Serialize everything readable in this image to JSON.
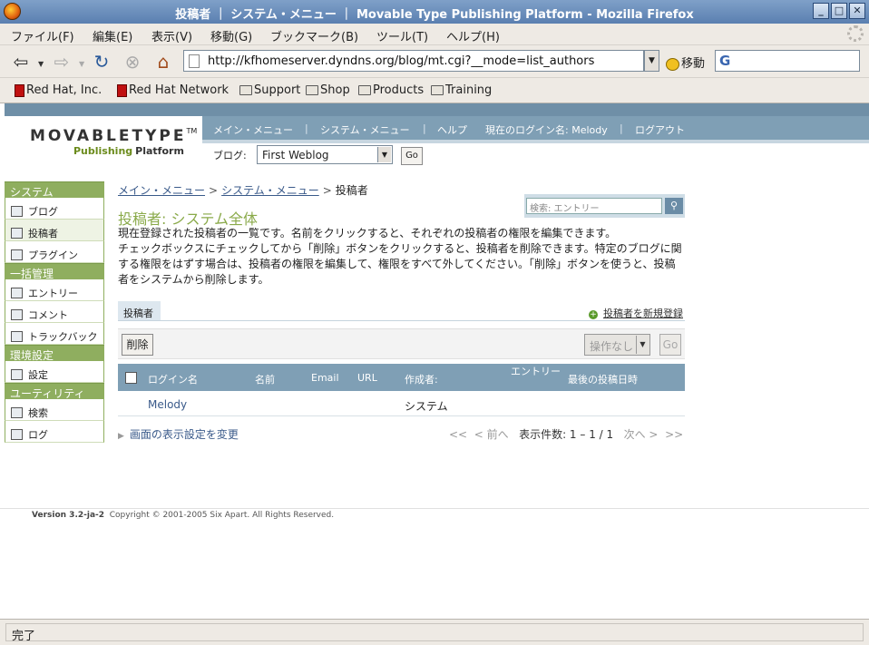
{
  "window": {
    "title": "投稿者 ｜ システム・メニュー ｜ Movable Type Publishing Platform - Mozilla Firefox",
    "min": "_",
    "max": "□",
    "close": "✕"
  },
  "menubar": [
    "ファイル(F)",
    "編集(E)",
    "表示(V)",
    "移動(G)",
    "ブックマーク(B)",
    "ツール(T)",
    "ヘルプ(H)"
  ],
  "navbar": {
    "back": "⇦",
    "forward": "⇨",
    "reload": "↻",
    "stop": "⊗",
    "home": "⌂",
    "url": "http://kfhomeserver.dyndns.org/blog/mt.cgi?__mode=list_authors",
    "go_label": "移動",
    "search_g": "G"
  },
  "bookmarks": [
    "Red Hat, Inc.",
    "Red Hat Network",
    "Support",
    "Shop",
    "Products",
    "Training"
  ],
  "mt": {
    "logo": {
      "word": "MOVABLETYPE",
      "tm": "TM",
      "sub_a": "Publishing",
      "sub_b": "Platform"
    },
    "topnav": [
      "メイン・メニュー",
      "システム・メニュー",
      "ヘルプ",
      "現在のログイン名: Melody",
      "ログアウト"
    ],
    "topnav_sep": "|",
    "blog_label": "ブログ:",
    "blog_value": "First Weblog",
    "blog_go": "Go"
  },
  "sidebar": [
    {
      "type": "head",
      "label": "システム"
    },
    {
      "type": "item",
      "label": "ブログ",
      "icon": "blog-icon"
    },
    {
      "type": "item",
      "label": "投稿者",
      "icon": "authors-icon",
      "active": true
    },
    {
      "type": "item",
      "label": "プラグイン",
      "icon": "plugin-icon"
    },
    {
      "type": "head",
      "label": "一括管理"
    },
    {
      "type": "item",
      "label": "エントリー",
      "icon": "entry-icon"
    },
    {
      "type": "item",
      "label": "コメント",
      "icon": "comment-icon"
    },
    {
      "type": "item",
      "label": "トラックバック",
      "icon": "trackback-icon"
    },
    {
      "type": "head",
      "label": "環境設定"
    },
    {
      "type": "item",
      "label": "設定",
      "icon": "settings-icon"
    },
    {
      "type": "head",
      "label": "ユーティリティ"
    },
    {
      "type": "item",
      "label": "検索",
      "icon": "search-icon"
    },
    {
      "type": "item",
      "label": "ログ",
      "icon": "log-icon"
    }
  ],
  "main": {
    "breadcrumb": {
      "main": "メイン・メニュー",
      "system": "システム・メニュー",
      "current": "投稿者",
      "arrow": ">"
    },
    "search_placeholder": "検索: エントリー",
    "title": "投稿者: システム全体",
    "desc": [
      "現在登録された投稿者の一覧です。名前をクリックすると、それぞれの投稿者の権限を編集できます。",
      "チェックボックスにチェックしてから「削除」ボタンをクリックすると、投稿者を削除できます。特定のブログに関する権限をはずす場合は、投稿者の権限を編集して、権限をすべて外してください。「削除」ボタンを使うと、投稿者をシステムから削除します。"
    ],
    "tab": "投稿者",
    "add_new": "投稿者を新規登録",
    "delete": "削除",
    "ops": "操作なし",
    "ops_go": "Go",
    "columns": [
      "ログイン名",
      "名前",
      "Email",
      "URL",
      "作成者:",
      "エントリー",
      "最後の投稿日時"
    ],
    "rows": [
      {
        "login": "Melody",
        "name": "",
        "email": "",
        "url": "",
        "creator": "システム",
        "entries": "",
        "last": ""
      }
    ],
    "display_options": "画面の表示設定を変更",
    "pager": {
      "first": "<<",
      "prev": "< 前へ",
      "count": "表示件数: 1 – 1 / 1",
      "next": "次へ >",
      "last": ">>"
    }
  },
  "footer": {
    "version": "Version 3.2-ja-2",
    "copyright": "Copyright © 2001-2005 Six Apart. All Rights Reserved."
  },
  "status": "完了"
}
